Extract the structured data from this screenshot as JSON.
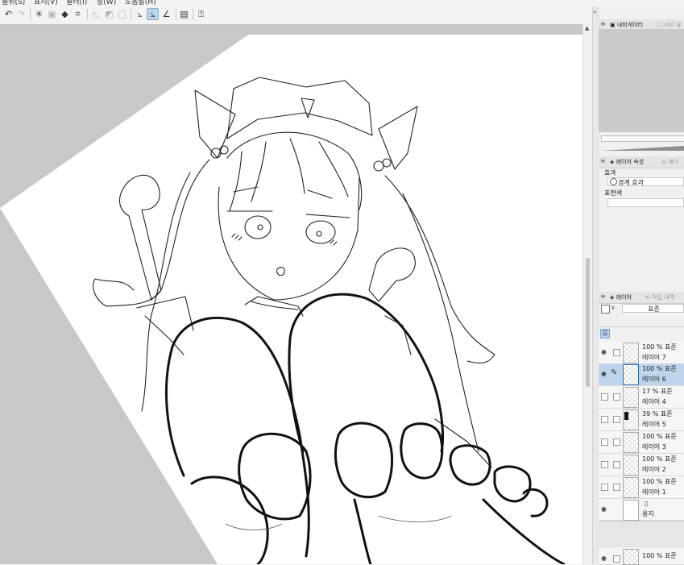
{
  "menu": {
    "items": [
      "필뒤(S)",
      "표시(V)",
      "필터(I)",
      "창(W)",
      "도움말(H)"
    ]
  },
  "toolbar": {
    "buttons": [
      "undo-icon",
      "redo-icon",
      "loading-icon",
      "copy-icon",
      "fill-icon",
      "transform-icon",
      "deselect-icon",
      "invert-selection-icon",
      "selection-border-icon",
      "ruler-pen-icon",
      "ruler-pen-active-icon",
      "ruler-angle-icon",
      "notes-icon",
      "help-icon"
    ]
  },
  "right_panel": {
    "collapse_glyph": "«",
    "navigator_tabs": {
      "navigator": "내비게이터",
      "second": "서브 뷰"
    },
    "layer_property": {
      "tabs": {
        "property": "레이어 속성",
        "second": "레이"
      },
      "effect_label": "효과",
      "border_effect": "경계 효과",
      "expression_label": "표현색"
    },
    "layer_panel": {
      "tabs": {
        "layer": "레이어",
        "history": "작업 내역"
      },
      "blend_mode": "표준",
      "layers": [
        {
          "blend": "100 % 표준",
          "name": "레이어 7",
          "visible": true,
          "selected": false,
          "editing": false,
          "thumb": "checker"
        },
        {
          "blend": "100 % 표준",
          "name": "레이어 6",
          "visible": true,
          "selected": true,
          "editing": true,
          "thumb": "checker"
        },
        {
          "blend": "17 % 표준",
          "name": "레이어 4",
          "visible": false,
          "selected": false,
          "editing": false,
          "thumb": "checker"
        },
        {
          "blend": "39 % 표준",
          "name": "레이어 5",
          "visible": false,
          "selected": false,
          "editing": false,
          "thumb": "dark"
        },
        {
          "blend": "100 % 표준",
          "name": "레이어 3",
          "visible": false,
          "selected": false,
          "editing": false,
          "thumb": "checker"
        },
        {
          "blend": "100 % 표준",
          "name": "레이어 2",
          "visible": false,
          "selected": false,
          "editing": false,
          "thumb": "checker"
        },
        {
          "blend": "100 % 표준",
          "name": "레이어 1",
          "visible": false,
          "selected": false,
          "editing": false,
          "thumb": "checker"
        }
      ],
      "paper": {
        "name": "용지",
        "visible": true
      },
      "bottom_layer": {
        "blend": "100 % 표준",
        "name": "",
        "visible": true
      }
    }
  },
  "colors": {
    "selected_row": "#bdd4ec",
    "canvas_bg": "#c8c8c8",
    "paper": "#ffffff",
    "panel_bg": "#f0f0f0"
  }
}
